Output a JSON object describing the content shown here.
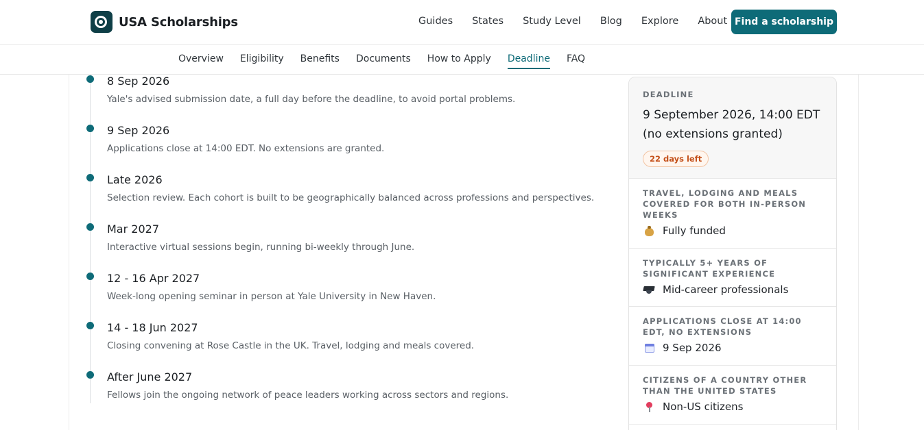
{
  "header": {
    "brand": "USA Scholarships",
    "nav": [
      "Guides",
      "States",
      "Study Level",
      "Blog",
      "Explore",
      "About"
    ],
    "cta": "Find a scholarship"
  },
  "tabs": {
    "items": [
      "Overview",
      "Eligibility",
      "Benefits",
      "Documents",
      "How to Apply",
      "Deadline",
      "FAQ"
    ],
    "active": "Deadline"
  },
  "timeline": [
    {
      "date": "8 Sep 2026",
      "desc": "Yale's advised submission date, a full day before the deadline, to avoid portal problems."
    },
    {
      "date": "9 Sep 2026",
      "desc": "Applications close at 14:00 EDT. No extensions are granted."
    },
    {
      "date": "Late 2026",
      "desc": "Selection review. Each cohort is built to be geographically balanced across professions and perspectives."
    },
    {
      "date": "Mar 2027",
      "desc": "Interactive virtual sessions begin, running bi-weekly through June."
    },
    {
      "date": "12 - 16 Apr 2027",
      "desc": "Week-long opening seminar in person at Yale University in New Haven."
    },
    {
      "date": "14 - 18 Jun 2027",
      "desc": "Closing convening at Rose Castle in the UK. Travel, lodging and meals covered."
    },
    {
      "date": "After June 2027",
      "desc": "Fellows join the ongoing network of peace leaders working across sectors and regions."
    }
  ],
  "sidebar": {
    "deadline_label": "DEADLINE",
    "deadline_value": "9 September 2026, 14:00 EDT (no extensions granted)",
    "badge": "22 days left",
    "facts": [
      {
        "label": "TRAVEL, LODGING AND MEALS COVERED FOR BOTH IN-PERSON WEEKS",
        "value": "Fully funded",
        "icon": "money-bag-icon"
      },
      {
        "label": "TYPICALLY 5+ YEARS OF SIGNIFICANT EXPERIENCE",
        "value": "Mid-career professionals",
        "icon": "graduation-cap-icon"
      },
      {
        "label": "APPLICATIONS CLOSE AT 14:00 EDT, NO EXTENSIONS",
        "value": "9 Sep 2026",
        "icon": "calendar-icon"
      },
      {
        "label": "CITIZENS OF A COUNTRY OTHER THAN THE UNITED STATES",
        "value": "Non-US citizens",
        "icon": "location-pin-icon"
      }
    ]
  },
  "colors": {
    "accent": "#0e6b78",
    "badge_text": "#c4501a"
  }
}
